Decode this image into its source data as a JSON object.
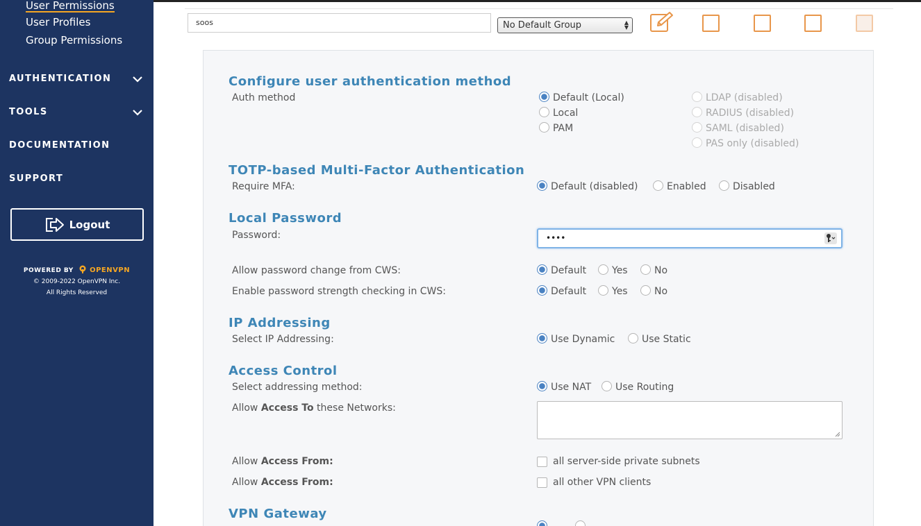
{
  "sidebar": {
    "sub_items": [
      "User Permissions",
      "User Profiles",
      "Group Permissions"
    ],
    "nav_items": [
      {
        "label": "AUTHENTICATION",
        "expandable": true
      },
      {
        "label": "TOOLS",
        "expandable": true
      },
      {
        "label": "DOCUMENTATION",
        "expandable": false
      },
      {
        "label": "SUPPORT",
        "expandable": false
      }
    ],
    "logout_label": "Logout",
    "powered_by": "POWERED BY",
    "brand": "OPENVPN",
    "copyright": "© 2009-2022 OpenVPN Inc.",
    "rights": "All Rights Reserved"
  },
  "user_row": {
    "username": "soos",
    "group_select": "No Default Group"
  },
  "sections": {
    "auth": {
      "title": "Configure user authentication method",
      "label": "Auth method",
      "options": [
        "Default (Local)",
        "Local",
        "PAM"
      ],
      "disabled_options": [
        "LDAP (disabled)",
        "RADIUS (disabled)",
        "SAML (disabled)",
        "PAS only (disabled)"
      ]
    },
    "mfa": {
      "title": "TOTP-based Multi-Factor Authentication",
      "label": "Require MFA:",
      "options": [
        "Default (disabled)",
        "Enabled",
        "Disabled"
      ]
    },
    "password": {
      "title": "Local Password",
      "label": "Password:",
      "value": "••••",
      "change_label": "Allow password change from CWS:",
      "strength_label": "Enable password strength checking in CWS:",
      "options": [
        "Default",
        "Yes",
        "No"
      ]
    },
    "ip": {
      "title": "IP Addressing",
      "label": "Select IP Addressing:",
      "options": [
        "Use Dynamic",
        "Use Static"
      ]
    },
    "access": {
      "title": "Access Control",
      "method_label": "Select addressing method:",
      "method_options": [
        "Use NAT",
        "Use Routing"
      ],
      "networks_label_pre": "Allow ",
      "networks_label_bold": "Access To",
      "networks_label_post": " these Networks:",
      "from_pre": "Allow ",
      "from_bold": "Access From:",
      "from_option_1": "all server-side private subnets",
      "from_option_2": "all other VPN clients"
    },
    "gateway": {
      "title": "VPN Gateway"
    }
  },
  "colors": {
    "sidebar_bg": "#1d3461",
    "accent_orange": "#f5a623",
    "section_title": "#3e86b6",
    "radio_on": "#4a82c2"
  }
}
